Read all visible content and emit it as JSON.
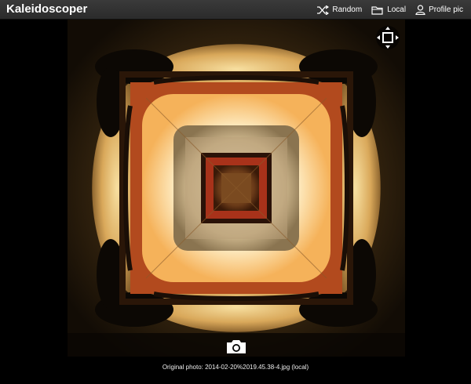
{
  "app": {
    "title": "Kaleidoscoper"
  },
  "nav": {
    "random_label": "Random",
    "local_label": "Local",
    "profile_label": "Profile pic"
  },
  "controls": {
    "fit_icon": "fit-square-arrows-icon",
    "camera_icon": "camera-icon"
  },
  "caption": {
    "text": "Original photo: 2014-02-20%2019.45.38-4.jpg (local)"
  },
  "colors": {
    "topbar": "#2f2f2f",
    "glow": "#fff6d8",
    "amber": "#f0a23a",
    "dark": "#1b120a"
  }
}
